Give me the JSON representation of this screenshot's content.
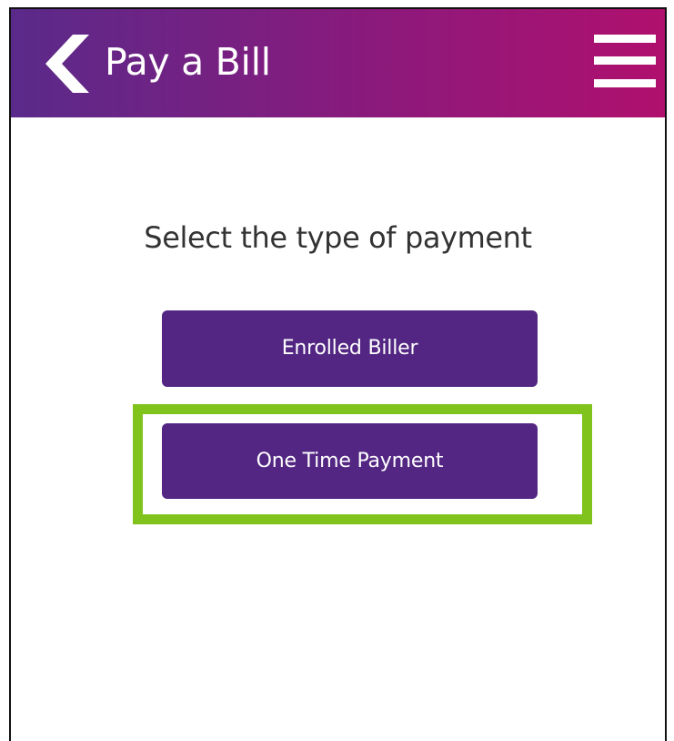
{
  "header": {
    "title": "Pay a Bill",
    "back_icon": "chevron-left-icon",
    "menu_icon": "hamburger-menu-icon",
    "gradient_start": "#5a2a8a",
    "gradient_end": "#b0106e"
  },
  "main": {
    "prompt": "Select the type of payment",
    "buttons": [
      {
        "label": "Enrolled Biller"
      },
      {
        "label": "One Time Payment"
      }
    ],
    "button_color": "#522682",
    "highlight_color": "#7fc31c"
  }
}
